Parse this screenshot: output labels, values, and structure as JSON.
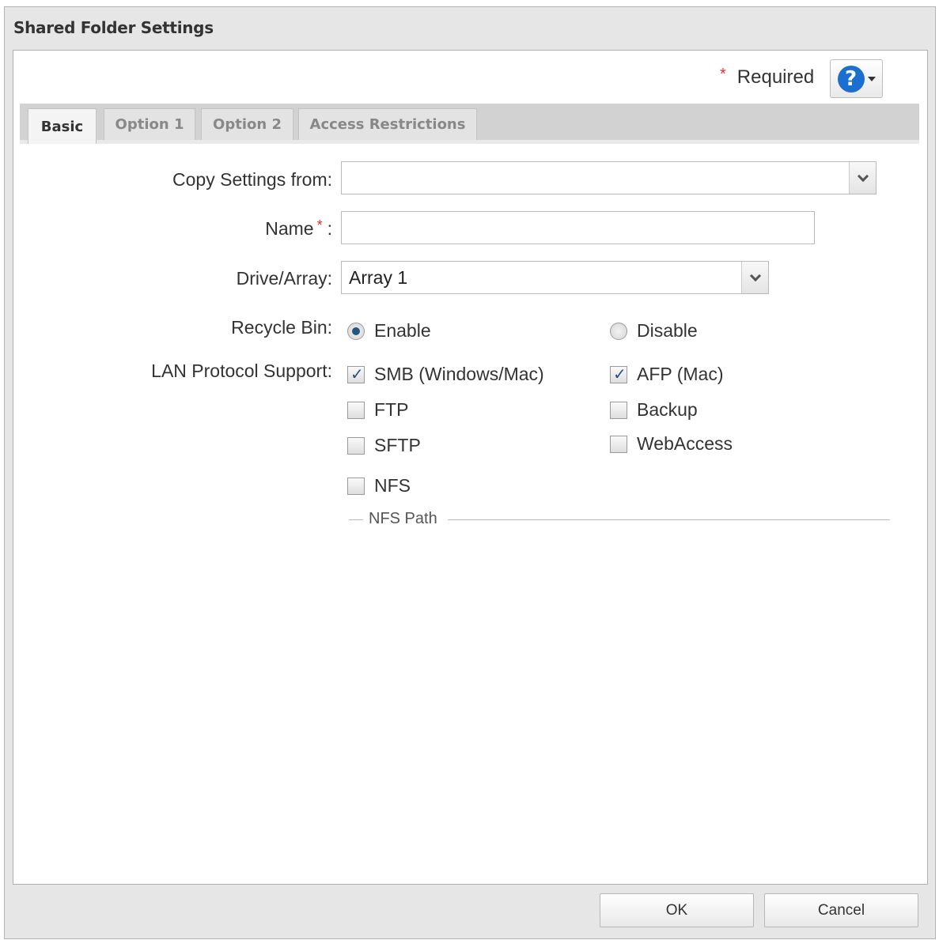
{
  "dialog": {
    "title": "Shared Folder Settings"
  },
  "header": {
    "required_star": "*",
    "required_label": "Required",
    "help_icon": "question-mark-icon",
    "help_glyph": "?"
  },
  "tabs": [
    {
      "label": "Basic",
      "active": true
    },
    {
      "label": "Option 1",
      "active": false
    },
    {
      "label": "Option 2",
      "active": false
    },
    {
      "label": "Access Restrictions",
      "active": false
    }
  ],
  "form": {
    "copy_settings": {
      "label": "Copy Settings from:",
      "value": ""
    },
    "name": {
      "label": "Name",
      "star": "*",
      "colon": ":",
      "value": ""
    },
    "drive_array": {
      "label": "Drive/Array:",
      "value": "Array 1"
    },
    "recycle_bin": {
      "label": "Recycle Bin:",
      "options": [
        {
          "label": "Enable",
          "selected": true
        },
        {
          "label": "Disable",
          "selected": false
        }
      ]
    },
    "lan_protocol": {
      "label": "LAN Protocol Support:",
      "options": [
        {
          "label": "SMB (Windows/Mac)",
          "checked": true
        },
        {
          "label": "AFP (Mac)",
          "checked": true
        },
        {
          "label": "FTP",
          "checked": false
        },
        {
          "label": "Backup",
          "checked": false
        },
        {
          "label": "SFTP",
          "checked": false
        },
        {
          "label": "WebAccess",
          "checked": false
        },
        {
          "label": "NFS",
          "checked": false
        }
      ]
    },
    "nfs_path": {
      "legend": "NFS Path"
    }
  },
  "footer": {
    "ok_label": "OK",
    "cancel_label": "Cancel"
  },
  "colors": {
    "accent": "#1a6fd0",
    "required": "#e03030",
    "checkmark": "#2a4e8a"
  }
}
